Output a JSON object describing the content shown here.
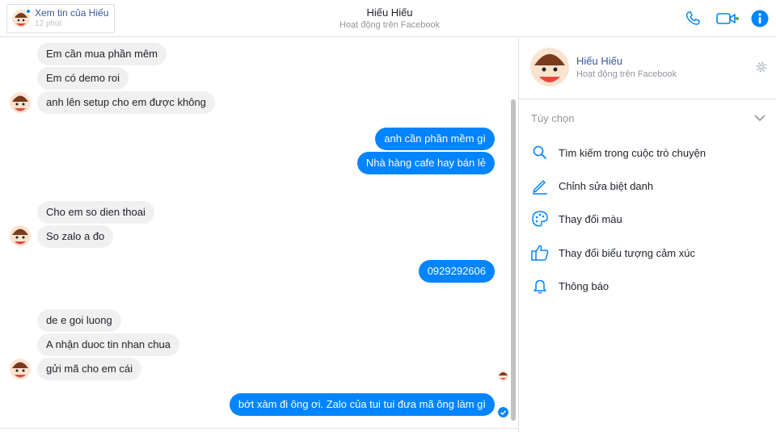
{
  "header": {
    "story_title": "Xem tin của Hiếu",
    "story_time": "12 phút",
    "contact_name": "Hiếu Hiếu",
    "contact_status": "Hoạt động trên Facebook"
  },
  "messages": [
    {
      "from": "them",
      "text": "Em cần mua phần mêm"
    },
    {
      "from": "them",
      "text": "Em có demo roi"
    },
    {
      "from": "them",
      "text": "anh lên setup cho em được không"
    },
    {
      "from": "me",
      "text": "anh cần phần mềm gì"
    },
    {
      "from": "me",
      "text": "Nhà hàng cafe hay bán lẻ"
    },
    {
      "from": "them",
      "text": "Cho em so dien thoai"
    },
    {
      "from": "them",
      "text": "So zalo a đo"
    },
    {
      "from": "me",
      "text": "0929292606"
    },
    {
      "from": "them",
      "text": "de e goi luong"
    },
    {
      "from": "them",
      "text": "A nhận duoc tin nhan chua"
    },
    {
      "from": "them",
      "text": "gửi mã cho em cái"
    },
    {
      "from": "me",
      "text": "bớt xàm đi ông ơi. Zalo của tui tui đưa mã ông làm gì"
    }
  ],
  "panel": {
    "name": "Hiếu Hiếu",
    "status": "Hoạt động trên Facebook",
    "options_title": "Tùy chọn",
    "options": [
      {
        "label": "Tìm kiếm trong cuộc trò chuyện",
        "icon": "search-icon"
      },
      {
        "label": "Chỉnh sửa biệt danh",
        "icon": "pencil-icon"
      },
      {
        "label": "Thay đổi màu",
        "icon": "palette-icon"
      },
      {
        "label": "Thay đổi biểu tượng cảm xúc",
        "icon": "thumbs-up-icon"
      },
      {
        "label": "Thông báo",
        "icon": "bell-icon"
      }
    ]
  },
  "colors": {
    "accent": "#0084ff",
    "incoming_bubble": "#f1f0f0",
    "link": "#365899",
    "online": "#42b72a"
  }
}
